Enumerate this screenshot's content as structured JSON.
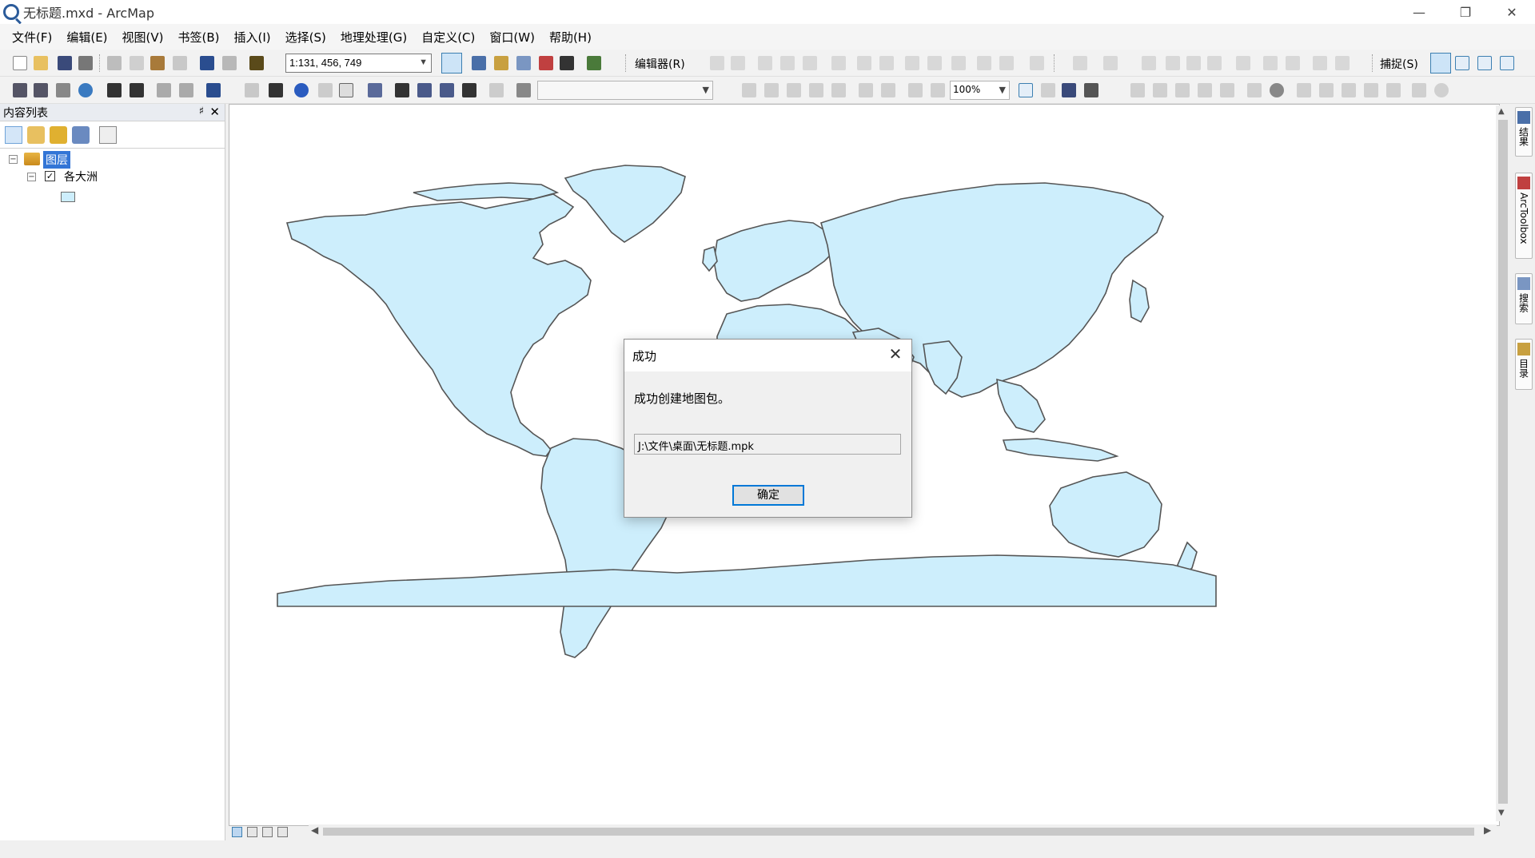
{
  "window": {
    "title": "无标题.mxd - ArcMap",
    "controls": [
      "minimize-icon",
      "restore-icon",
      "close-icon"
    ]
  },
  "menu": [
    "文件(F)",
    "编辑(E)",
    "视图(V)",
    "书签(B)",
    "插入(I)",
    "选择(S)",
    "地理处理(G)",
    "自定义(C)",
    "窗口(W)",
    "帮助(H)"
  ],
  "toolbar": {
    "scale": "1:131, 456, 749",
    "editor": "编辑器(R)",
    "snapping": "捕捉(S)",
    "zoom": "100%"
  },
  "toc": {
    "title": "内容列表",
    "pin": "♯",
    "close": "✕",
    "root": "图层",
    "layer": "各大洲",
    "layer_checked": "✓"
  },
  "dock": [
    "结果",
    "ArcToolbox",
    "搜索",
    "目录"
  ],
  "dialog": {
    "title": "成功",
    "message": "成功创建地图包。",
    "path": "J:\\文件\\桌面\\无标题.mpk",
    "ok": "确定"
  },
  "colors": {
    "land_fill": "#cdeefc",
    "land_stroke": "#555555",
    "accent": "#0078d7",
    "selection": "#3375d6"
  }
}
